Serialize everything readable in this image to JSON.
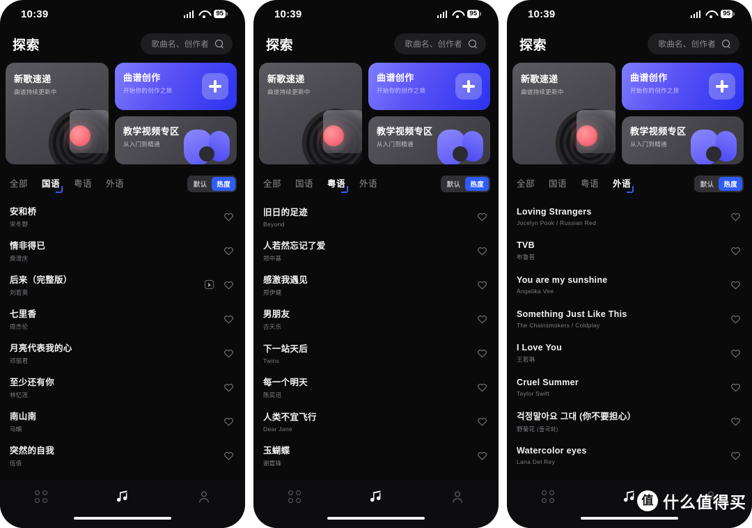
{
  "status_bar": {
    "time": "10:39",
    "battery": "95",
    "signal_icon": "cellular-signal-icon",
    "wifi_icon": "wifi-icon"
  },
  "header": {
    "title": "探索",
    "search_placeholder": "歌曲名、创作者",
    "search_icon": "search-icon"
  },
  "cards": {
    "new_songs": {
      "title": "新歌速递",
      "subtitle": "曲谱持续更新中"
    },
    "compose": {
      "title": "曲谱创作",
      "subtitle": "开始你的创作之旅",
      "action_icon": "plus-icon"
    },
    "tutorial": {
      "title": "教学视频专区",
      "subtitle": "从入门到精通"
    }
  },
  "filters": {
    "languages": [
      "全部",
      "国语",
      "粤语",
      "外语"
    ],
    "sort_options": [
      "默认",
      "热度"
    ],
    "sort_active": "热度"
  },
  "theme": {
    "accent": "#2f5cf6",
    "card_blue": "#4a46ef",
    "background": "#0a0a0a",
    "text_primary": "#f2f2f4",
    "text_secondary": "#7e7e86"
  },
  "nav": {
    "items": [
      {
        "icon": "grid-icon",
        "active": false
      },
      {
        "icon": "music-note-icon",
        "active": true
      },
      {
        "icon": "person-icon",
        "active": false
      }
    ]
  },
  "watermark": {
    "logo": "值",
    "text": "什么值得买"
  },
  "screens": [
    {
      "id": "screen-mandarin",
      "active_language": "国语",
      "songs": [
        {
          "title": "安和桥",
          "artist": "宋冬野",
          "has_play": false
        },
        {
          "title": "情非得已",
          "artist": "庾澄庆",
          "has_play": false
        },
        {
          "title": "后来（完整版）",
          "artist": "刘若英",
          "has_play": true
        },
        {
          "title": "七里香",
          "artist": "周杰伦",
          "has_play": false
        },
        {
          "title": "月亮代表我的心",
          "artist": "邓丽君",
          "has_play": false
        },
        {
          "title": "至少还有你",
          "artist": "林忆莲",
          "has_play": false
        },
        {
          "title": "南山南",
          "artist": "马頔",
          "has_play": false
        },
        {
          "title": "突然的自我",
          "artist": "伍佰",
          "has_play": false
        }
      ]
    },
    {
      "id": "screen-cantonese",
      "active_language": "粤语",
      "songs": [
        {
          "title": "旧日的足迹",
          "artist": "Beyond",
          "has_play": false
        },
        {
          "title": "人若然忘记了爱",
          "artist": "郑中基",
          "has_play": false
        },
        {
          "title": "感激我遇见",
          "artist": "郑伊健",
          "has_play": false
        },
        {
          "title": "男朋友",
          "artist": "古天乐",
          "has_play": false
        },
        {
          "title": "下一站天后",
          "artist": "Twins",
          "has_play": false
        },
        {
          "title": "每一个明天",
          "artist": "陈奕迅",
          "has_play": false
        },
        {
          "title": "人类不宜飞行",
          "artist": "Dear Jane",
          "has_play": false
        },
        {
          "title": "玉蝴蝶",
          "artist": "谢霆锋",
          "has_play": false
        }
      ]
    },
    {
      "id": "screen-foreign",
      "active_language": "外语",
      "songs": [
        {
          "title": "Loving Strangers",
          "artist": "Jocelyn Pook / Russian Red",
          "has_play": false
        },
        {
          "title": "TVB",
          "artist": "布鲁普",
          "has_play": false
        },
        {
          "title": "You are my sunshine",
          "artist": "Angelika Vee",
          "has_play": false
        },
        {
          "title": "Something Just Like This",
          "artist": "The Chainsmokers / Coldplay",
          "has_play": false
        },
        {
          "title": "I Love You",
          "artist": "王若琳",
          "has_play": false
        },
        {
          "title": "Cruel Summer",
          "artist": "Taylor Swift",
          "has_play": false
        },
        {
          "title": "걱정말아요 그대 (你不要担心）",
          "artist": "野菊花 (들국화)",
          "has_play": false
        },
        {
          "title": "Watercolor eyes",
          "artist": "Lana Del Rey",
          "has_play": false
        }
      ]
    }
  ]
}
